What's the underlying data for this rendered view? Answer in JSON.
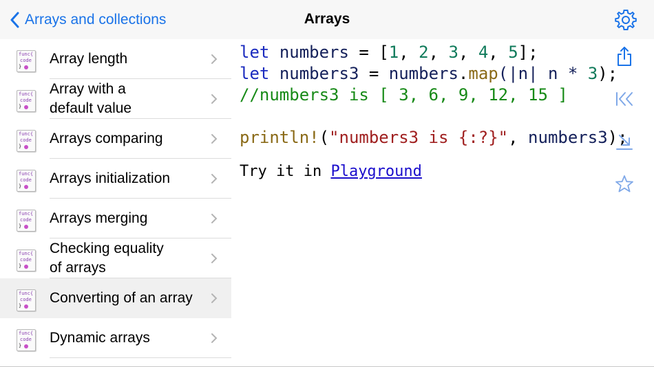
{
  "nav": {
    "back_label": "Arrays and collections",
    "title": "Arrays"
  },
  "sidebar": {
    "items": [
      {
        "label": "Array length"
      },
      {
        "label": "Array with a\ndefault value"
      },
      {
        "label": "Arrays comparing"
      },
      {
        "label": "Arrays initialization"
      },
      {
        "label": "Arrays merging"
      },
      {
        "label": "Checking equality\nof arrays"
      },
      {
        "label": "Converting of an array"
      },
      {
        "label": "Dynamic arrays"
      }
    ],
    "selected_index": 6,
    "icon_text": {
      "line1": "func{",
      "line2": "code",
      "line3": "}"
    }
  },
  "code": {
    "line1": {
      "kw": "let",
      "var": "numbers",
      "rest": " = [",
      "n1": "1",
      "n2": "2",
      "n3": "3",
      "n4": "4",
      "n5": "5",
      "end": "];"
    },
    "line2": {
      "kw": "let",
      "var": "numbers3",
      "eq": " = ",
      "obj": "numbers",
      "dot": ".",
      "fn": "map",
      "args": "(|n| n * ",
      "num": "3",
      "end": ");"
    },
    "line3": "//numbers3 is [ 3, 6, 9, 12, 15 ]",
    "line4": {
      "mac": "println!",
      "open": "(",
      "str": "\"numbers3 is {:?}\"",
      "comma": ", ",
      "var": "numbers3",
      "end": ");"
    }
  },
  "try": {
    "prefix": "Try it in ",
    "link": "Playground"
  },
  "icons": {
    "back": "chevron-left-icon",
    "settings": "gear-icon",
    "share": "share-icon",
    "first": "skip-to-start-icon",
    "download": "download-icon",
    "favorite": "star-icon"
  },
  "colors": {
    "accent": "#1a73e8",
    "keyword": "#1b2bbf",
    "comment": "#178a17",
    "number": "#0f7a5a",
    "string": "#a02020"
  }
}
